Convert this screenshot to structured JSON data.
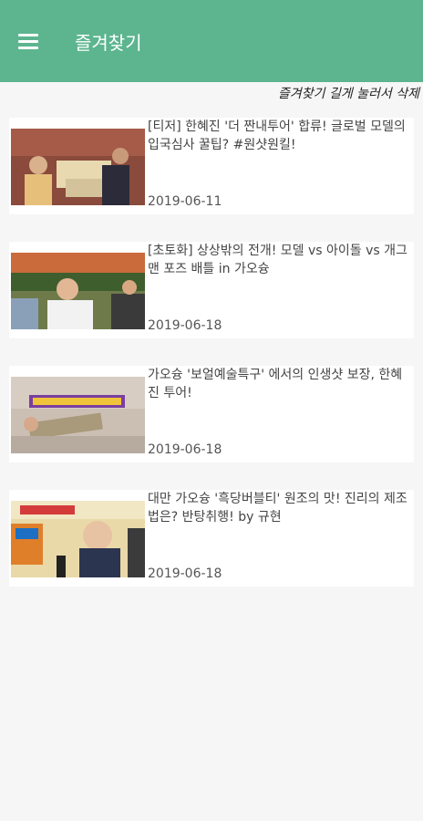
{
  "appbar": {
    "title": "즐겨찾기",
    "menu_icon": "hamburger-menu-icon",
    "color": "#5cb58f"
  },
  "hint": "즐겨찾기 길게 눌러서 삭제",
  "videos": [
    {
      "title": "[티저] 한혜진 '더 짠내투어' 합류! 글로벌 모델의 입국심사 꿀팁? #원샷원킬!",
      "date": "2019-06-11"
    },
    {
      "title": "[초토화] 상상밖의 전개! 모델 vs 아이돌 vs 개그맨 포즈 배틀 in 가오슝",
      "date": "2019-06-18"
    },
    {
      "title": "가오슝 '보얼예술특구' 에서의 인생샷 보장, 한혜진 투어!",
      "date": "2019-06-18"
    },
    {
      "title": "대만 가오슝 '흑당버블티' 원조의 맛! 진리의 제조법은? 반탕취행! by 규현",
      "date": "2019-06-18"
    }
  ]
}
